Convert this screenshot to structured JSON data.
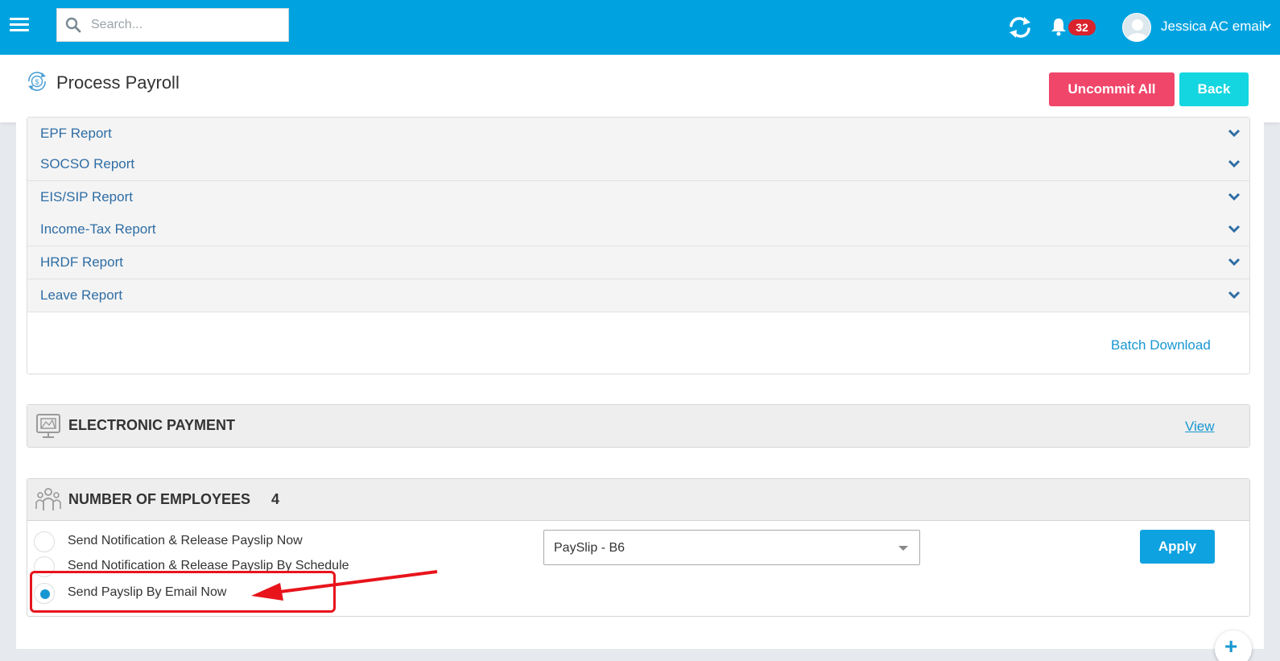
{
  "topbar": {
    "search_placeholder": "Search...",
    "notification_count": "32",
    "user_name": "Jessica AC email",
    "icons": [
      "menu-icon",
      "search-icon",
      "sync-icon",
      "bell-icon",
      "avatar",
      "chevron-down-icon"
    ]
  },
  "header": {
    "title": "Process Payroll",
    "uncommit_label": "Uncommit All",
    "back_label": "Back"
  },
  "reports": {
    "items": [
      {
        "label": "EPF Report"
      },
      {
        "label": "SOCSO Report"
      },
      {
        "label": "EIS/SIP Report"
      },
      {
        "label": "Income-Tax Report"
      },
      {
        "label": "HRDF Report"
      },
      {
        "label": "Leave Report"
      }
    ],
    "batch_download_label": "Batch Download"
  },
  "electronic_payment": {
    "title": "ELECTRONIC PAYMENT",
    "view_label": "View"
  },
  "employees": {
    "title": "NUMBER OF EMPLOYEES",
    "count": "4",
    "options": [
      {
        "label": "Send Notification & Release Payslip Now",
        "checked": false
      },
      {
        "label": "Send Notification & Release Payslip By Schedule",
        "checked": false
      },
      {
        "label": "Send Payslip By Email Now",
        "checked": true
      }
    ],
    "template_selected": "PaySlip - B6",
    "apply_label": "Apply"
  },
  "colors": {
    "topbar": "#00a3e0",
    "uncommit": "#f0466a",
    "back": "#14d6e0",
    "apply": "#0ea2e0",
    "link": "#2e6da4",
    "annotation": "#e8141c"
  }
}
